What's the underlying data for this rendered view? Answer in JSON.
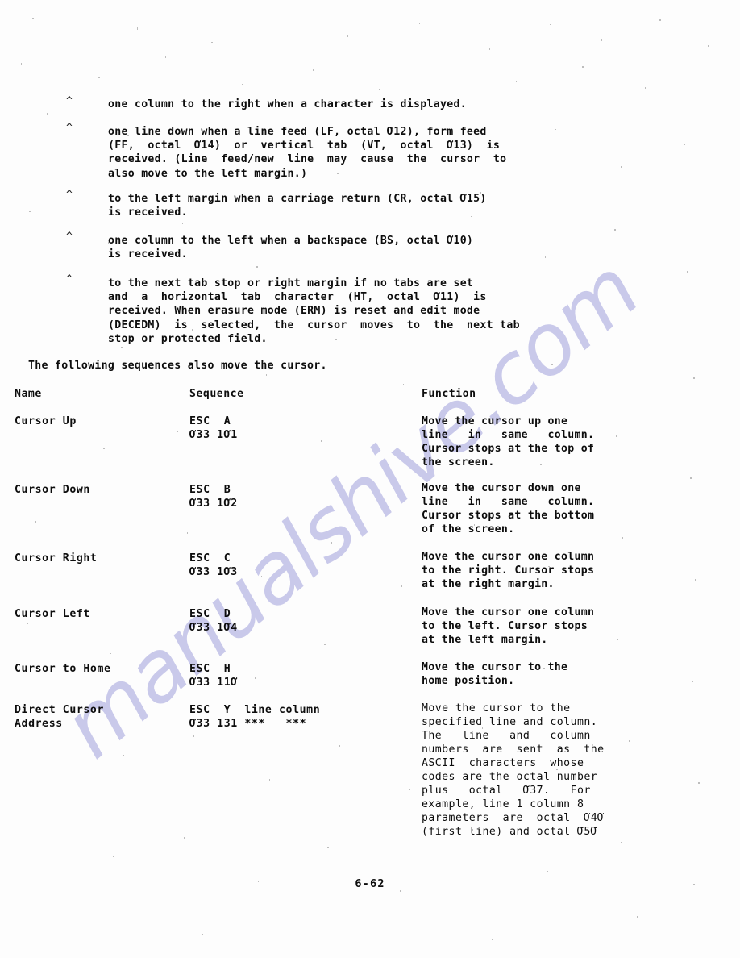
{
  "page": {
    "footer": "6-62",
    "watermark": "manualshive.com"
  },
  "bullets": [
    {
      "marker": "^",
      "lines": [
        "one column to the right when a character is displayed."
      ]
    },
    {
      "marker": "^",
      "lines": [
        "one line down when a line feed (LF, octal Ơ12), form feed",
        "(FF,  octal  Ơ14)  or  vertical  tab  (VT,  octal  Ơ13)  is",
        "received. (Line  feed/new  line  may  cause  the  cursor  to",
        "also move to the left margin.)"
      ]
    },
    {
      "marker": "^",
      "lines": [
        "to the left margin when a carriage return (CR, octal Ơ15)",
        "is received."
      ]
    },
    {
      "marker": "^",
      "lines": [
        "one column to the left when a backspace (BS, octal Ơ10)",
        "is received."
      ]
    },
    {
      "marker": "^",
      "lines": [
        "to the next tab stop or right margin if no tabs are set",
        "and  a  horizontal  tab  character  (HT,  octal  Ơ11)  is",
        "received. When erasure mode (ERM) is reset and edit mode",
        "(DECEDM)  is  selected,  the  cursor  moves  to  the  next tab",
        "stop or protected field."
      ]
    }
  ],
  "intro": "The following sequences also move the cursor.",
  "table": {
    "headers": {
      "name": "Name",
      "sequence": "Sequence",
      "function": "Function"
    },
    "rows": [
      {
        "name_lines": [
          "Cursor Up"
        ],
        "sequence_lines": [
          "ESC  A",
          "Ơ33 1Ơ1"
        ],
        "function_lines": [
          "Move the cursor up one",
          "line   in   same   column.",
          "Cursor stops at the top of",
          "the screen."
        ]
      },
      {
        "name_lines": [
          "Cursor Down"
        ],
        "sequence_lines": [
          "ESC  B",
          "Ơ33 1Ơ2"
        ],
        "function_lines": [
          "Move the cursor down one",
          "line   in   same   column.",
          "Cursor stops at the bottom",
          "of the screen."
        ]
      },
      {
        "name_lines": [
          "Cursor Right"
        ],
        "sequence_lines": [
          "ESC  C",
          "Ơ33 1Ơ3"
        ],
        "function_lines": [
          "Move the cursor one column",
          "to the right. Cursor stops",
          "at the right margin."
        ]
      },
      {
        "name_lines": [
          "Cursor Left"
        ],
        "sequence_lines": [
          "ESC  D",
          "Ơ33 1Ơ4"
        ],
        "function_lines": [
          "Move the cursor one column",
          "to the left. Cursor stops",
          "at the left margin."
        ]
      },
      {
        "name_lines": [
          "Cursor to Home"
        ],
        "sequence_lines": [
          "ESC  H",
          "Ơ33 11Ơ"
        ],
        "function_lines": [
          "Move the cursor to the",
          "home position."
        ]
      },
      {
        "name_lines": [
          "Direct Cursor",
          "Address"
        ],
        "sequence_lines": [
          "ESC  Y  line column",
          "Ơ33 131 ***   ***"
        ],
        "function_lines": [
          "Move the cursor to the",
          "specified line and column.",
          "The   line   and   column",
          "numbers  are  sent  as  the",
          "ASCII  characters  whose",
          "codes are the octal number",
          "plus   octal   Ơ37.   For",
          "example, line 1 column 8",
          "parameters  are  octal  Ơ4Ơ",
          "(first line) and octal Ơ5Ơ"
        ]
      }
    ]
  }
}
